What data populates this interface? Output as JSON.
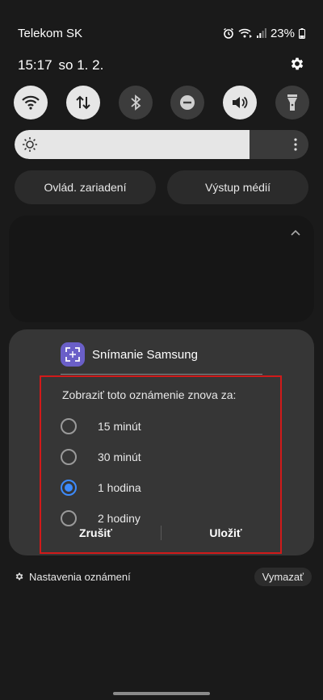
{
  "status": {
    "carrier": "Telekom SK",
    "battery": "23%",
    "icons": [
      "alarm-icon",
      "wifi-call-icon",
      "signal-icon",
      "battery-icon"
    ]
  },
  "header": {
    "time": "15:17",
    "date": "so 1. 2.",
    "settings_icon": "gear-icon"
  },
  "quick_toggles": [
    {
      "name": "wifi",
      "on": true
    },
    {
      "name": "mobile-data",
      "on": true
    },
    {
      "name": "bluetooth",
      "on": false
    },
    {
      "name": "do-not-disturb",
      "on": false
    },
    {
      "name": "sound",
      "on": true
    },
    {
      "name": "flashlight",
      "on": false
    }
  ],
  "brightness": {
    "level": 0.8
  },
  "buttons": {
    "device_control": "Ovlád. zariadení",
    "media_output": "Výstup médií"
  },
  "notification": {
    "app_name": "Snímanie Samsung",
    "snooze_title": "Zobraziť toto oznámenie znova za:",
    "options": [
      {
        "label": "15 minút",
        "selected": false
      },
      {
        "label": "30 minút",
        "selected": false
      },
      {
        "label": "1 hodina",
        "selected": true
      },
      {
        "label": "2 hodiny",
        "selected": false
      }
    ],
    "cancel_label": "Zrušiť",
    "save_label": "Uložiť"
  },
  "footer": {
    "settings_label": "Nastavenia oznámení",
    "clear_label": "Vymazať"
  },
  "colors": {
    "accent": "#3d8bfd",
    "highlight_border": "#d11a1a",
    "app_icon": "#6a5fc8"
  }
}
